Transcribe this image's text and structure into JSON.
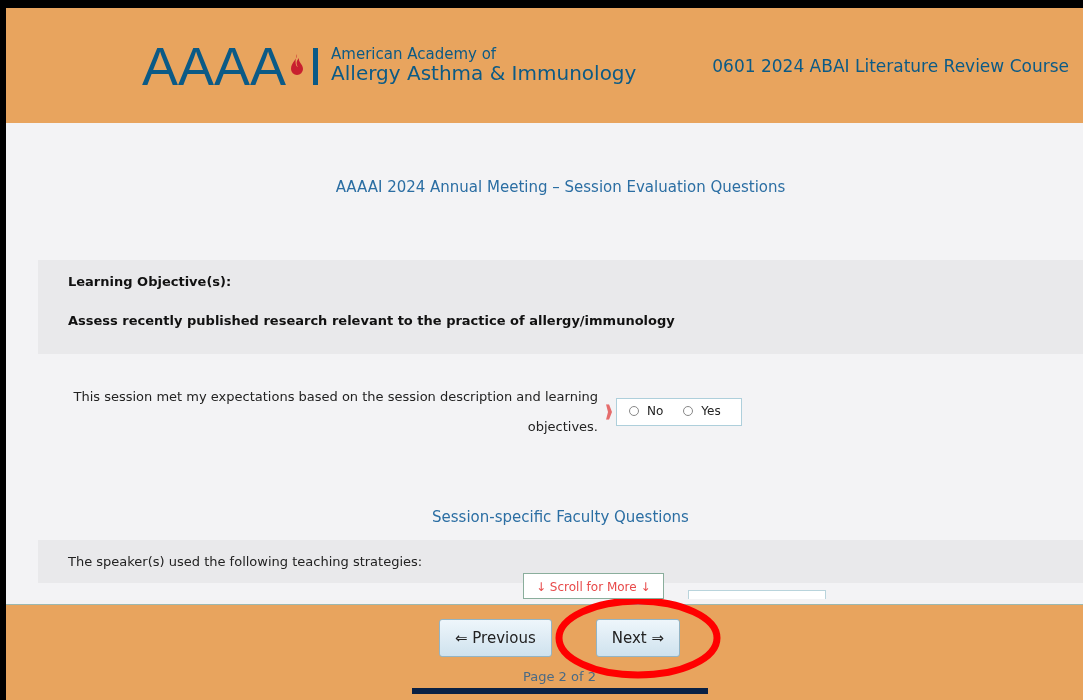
{
  "header": {
    "logo": {
      "mark": "AAAA",
      "mark_end": "I",
      "line_1": "American Academy of",
      "line_2": "Allergy Asthma & Immunology"
    },
    "course_title": "0601 2024 ABAI Literature Review Course"
  },
  "form": {
    "title": "AAAAI 2024 Annual Meeting – Session Evaluation Questions",
    "objectives": {
      "label": "Learning Objective(s):",
      "text": "Assess recently published research relevant to the practice of allergy/immunology"
    },
    "question": {
      "text": "This session met my expectations based on the session description and learning objectives.",
      "required": true,
      "options": [
        {
          "label": "No",
          "selected": false
        },
        {
          "label": "Yes",
          "selected": false
        }
      ]
    },
    "section_title": "Session-specific Faculty Questions",
    "strategies_prompt": "The speaker(s) used the following teaching strategies:"
  },
  "scroll_hint": "↓ Scroll for More ↓",
  "footer": {
    "buttons": [
      {
        "label": "⇐ Previous",
        "highlighted": false
      },
      {
        "label": "Next ⇒",
        "highlighted": true
      }
    ],
    "page": "Page 2 of 2"
  }
}
